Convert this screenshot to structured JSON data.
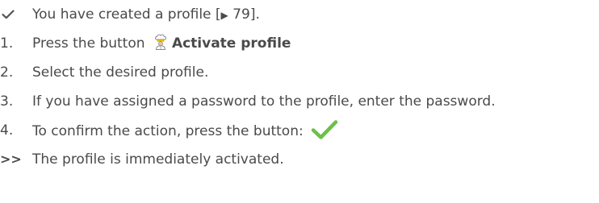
{
  "prerequisite": {
    "text": "You have created a profile [",
    "link_arrow": "▶",
    "link_page": " 79",
    "close": "]."
  },
  "steps": [
    {
      "number": "1.",
      "text": "Press the button ",
      "bold": "Activate profile"
    },
    {
      "number": "2.",
      "text": "Select the desired profile."
    },
    {
      "number": "3.",
      "text": "If you have assigned a password to the profile, enter the password."
    },
    {
      "number": "4.",
      "text": "To confirm the action, press the button: "
    }
  ],
  "result": {
    "marker": ">>",
    "text": "The profile is immediately activated."
  },
  "icons": {
    "prerequisite": "checkmark-icon",
    "activate_profile": "chef-icon",
    "confirm": "green-checkmark-icon"
  },
  "colors": {
    "text": "#4a4a4a",
    "confirm_green": "#6cc04a"
  }
}
